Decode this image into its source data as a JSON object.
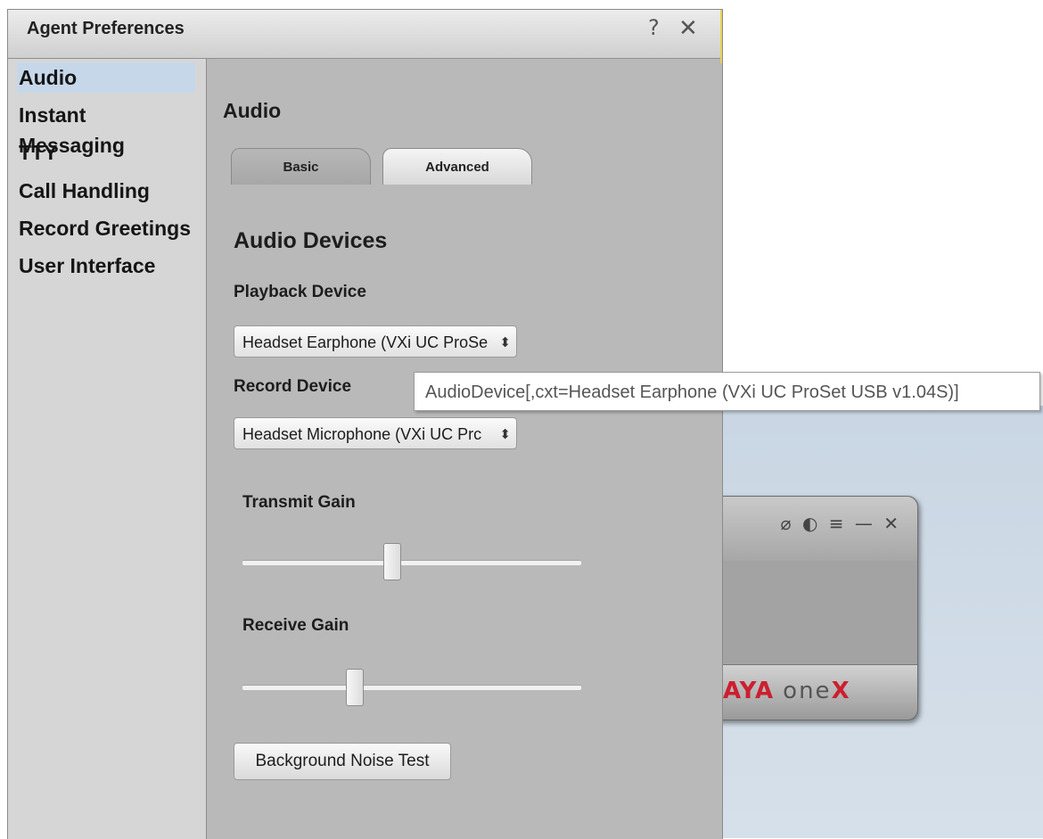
{
  "dialog": {
    "title": "Agent Preferences",
    "help_glyph": "?",
    "close_glyph": "✕"
  },
  "sidebar": {
    "items": [
      {
        "label": "Audio",
        "selected": true
      },
      {
        "label": "Instant Messaging",
        "selected": false
      },
      {
        "label": "TTY",
        "selected": false
      },
      {
        "label": "Call Handling",
        "selected": false
      },
      {
        "label": "Record Greetings",
        "selected": false
      },
      {
        "label": "User Interface",
        "selected": false
      }
    ]
  },
  "content": {
    "heading": "Audio",
    "tabs": [
      {
        "label": "Basic",
        "active": false
      },
      {
        "label": "Advanced",
        "active": true
      }
    ],
    "section_heading": "Audio Devices",
    "playback": {
      "label": "Playback Device",
      "value": "Headset Earphone (VXi UC ProSe"
    },
    "record": {
      "label": "Record Device",
      "value": "Headset Microphone (VXi UC Prc"
    },
    "transmit_gain": {
      "label": "Transmit Gain",
      "level_fraction": 0.44
    },
    "receive_gain": {
      "label": "Receive Gain",
      "level_fraction": 0.33
    },
    "noise_test_button": "Background Noise Test"
  },
  "tooltip": {
    "text": "AudioDevice[,cxt=Headset Earphone (VXi UC ProSet USB v1.04S)]"
  },
  "background_app": {
    "logo_avaya": "AYA",
    "logo_one": "one",
    "logo_x": "X",
    "colors": {
      "brand_red": "#cc1f2f",
      "selection": "#c6d7ea"
    }
  }
}
